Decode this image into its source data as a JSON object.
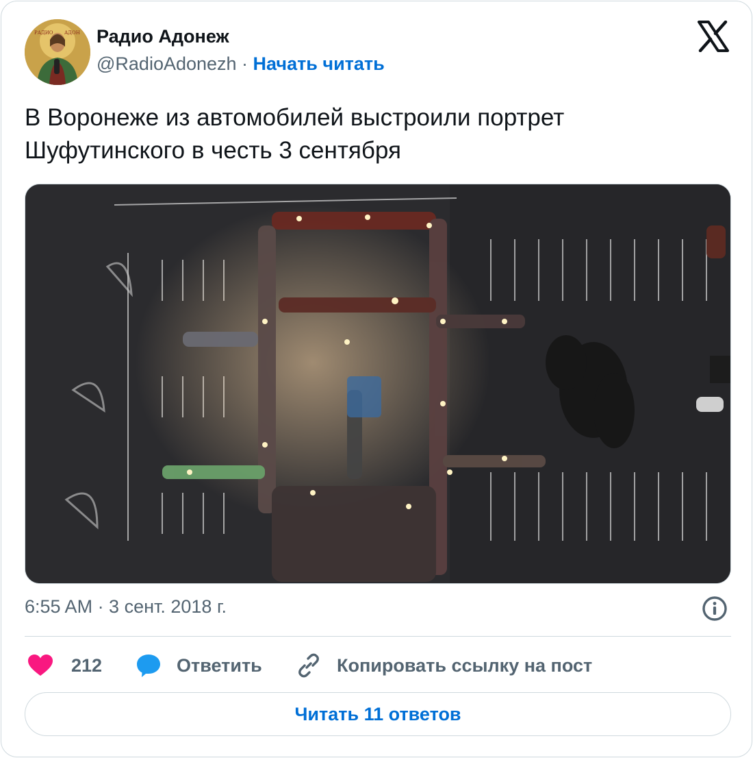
{
  "author": {
    "name": "Радио Адонеж",
    "handle": "@RadioAdonezh",
    "separator": " · ",
    "follow_label": "Начать читать"
  },
  "tweet": {
    "text_line1": "В Воронеже из автомобилей выстроили портрет",
    "text_line2": "Шуфутинского в честь 3 сентября"
  },
  "media": {
    "description_icon": "aerial-night-parking-photo"
  },
  "meta": {
    "timestamp": "6:55 AM · 3 сент. 2018 г."
  },
  "actions": {
    "likes_count": "212",
    "reply_label": "Ответить",
    "copy_label": "Копировать ссылку на пост"
  },
  "footer": {
    "read_replies_label": "Читать 11 ответов"
  },
  "colors": {
    "accent": "#006fd6",
    "like": "#f91880",
    "reply": "#1d9bf0",
    "muted": "#536471",
    "border": "#cfd9de"
  }
}
